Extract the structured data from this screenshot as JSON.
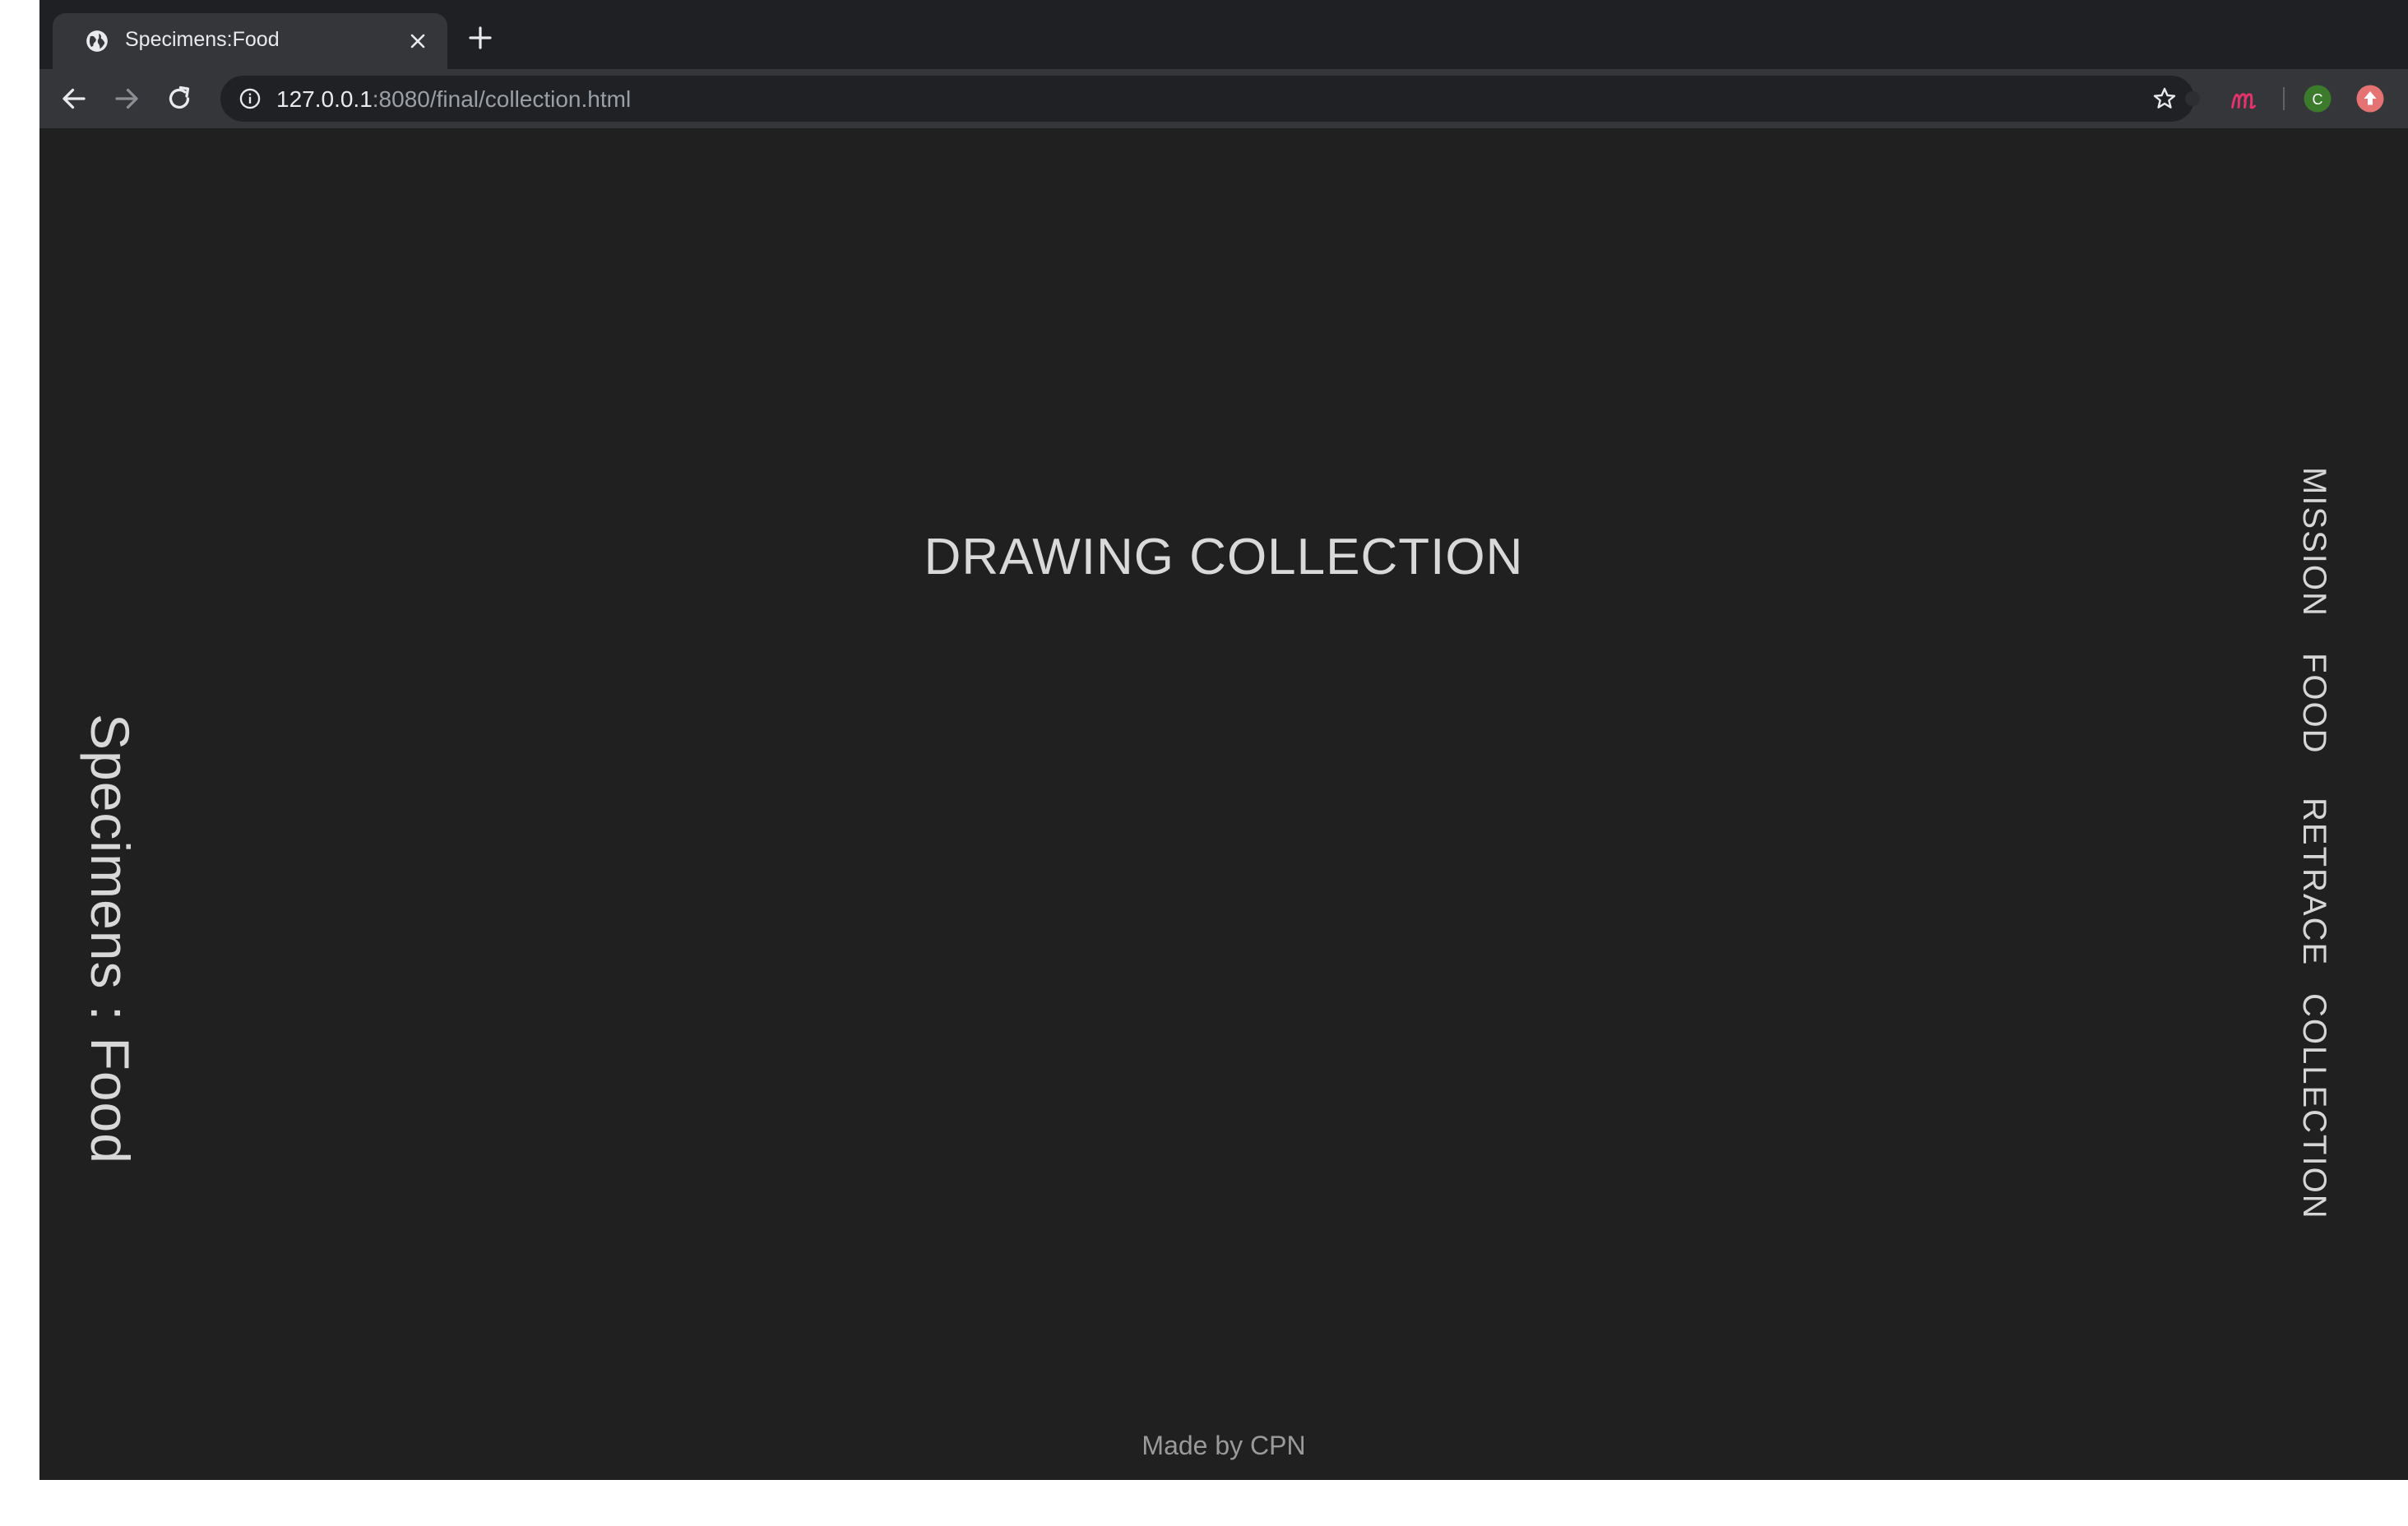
{
  "browser": {
    "tab": {
      "title": "Specimens:Food"
    },
    "address_bar": {
      "host": "127.0.0.1",
      "path": ":8080/final/collection.html"
    },
    "extensions": {
      "profile_initial": "C"
    },
    "colors": {
      "extension_m": "#e2336b",
      "profile_bg": "#3c7a2c",
      "extension_last": "#e57373"
    }
  },
  "page": {
    "site_title": "Specimens : Food",
    "heading": "DRAWING COLLECTION",
    "nav": [
      {
        "label": "MISSION"
      },
      {
        "label": "FOOD"
      },
      {
        "label": "RETRACE"
      },
      {
        "label": "COLLECTION"
      }
    ],
    "footer": "Made by CPN"
  }
}
